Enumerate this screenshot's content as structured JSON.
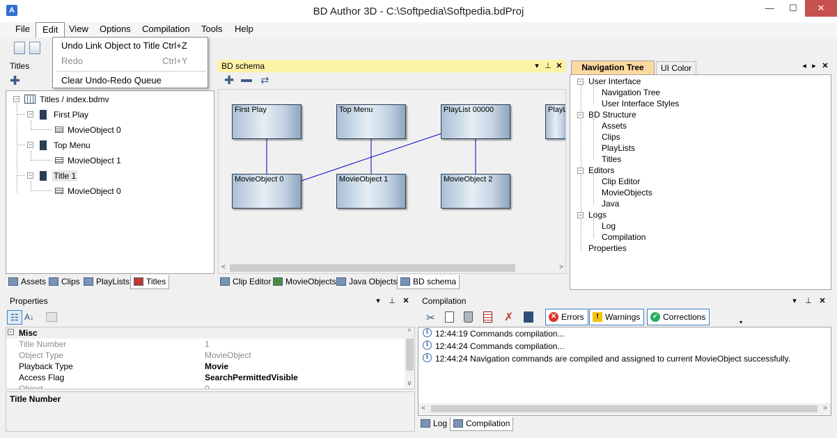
{
  "window": {
    "title": "BD Author 3D - C:\\Softpedia\\Softpedia.bdProj",
    "app_icon_letter": "A",
    "minimize": "—",
    "maximize": "☐",
    "close": "✕"
  },
  "menu": [
    "File",
    "Edit",
    "View",
    "Options",
    "Compilation",
    "Tools",
    "Help"
  ],
  "edit_menu": {
    "items": [
      {
        "label": "Undo Link Object to Title",
        "shortcut": "Ctrl+Z",
        "enabled": true
      },
      {
        "label": "Redo",
        "shortcut": "Ctrl+Y",
        "enabled": false
      },
      {
        "label": "Clear Undo-Redo Queue",
        "shortcut": "",
        "enabled": true
      }
    ]
  },
  "titles_panel": {
    "title": "Titles",
    "tree": [
      {
        "label": "Titles / index.bdmv"
      },
      {
        "label": "First Play"
      },
      {
        "label": "MovieObject 0"
      },
      {
        "label": "Top Menu"
      },
      {
        "label": "MovieObject 1"
      },
      {
        "label": "Title 1"
      },
      {
        "label": "MovieObject 0"
      }
    ],
    "tabs": [
      "Assets",
      "Clips",
      "PlayLists",
      "Titles"
    ],
    "active_tab": "Titles"
  },
  "schema_panel": {
    "title": "BD schema",
    "nodes": [
      "First Play",
      "Top Menu",
      "PlayList 00000",
      "PlayLi",
      "MovieObject 0",
      "MovieObject 1",
      "MovieObject 2"
    ],
    "tabs": [
      "Clip Editor",
      "MovieObjects",
      "Java Objects",
      "BD schema"
    ],
    "active_tab": "BD schema"
  },
  "nav_panel": {
    "tabs": [
      "Navigation Tree",
      "UI Color"
    ],
    "active_tab": "Navigation Tree",
    "tree": [
      {
        "label": "User Interface"
      },
      {
        "label": "Navigation Tree"
      },
      {
        "label": "User Interface Styles"
      },
      {
        "label": "BD Structure"
      },
      {
        "label": "Assets"
      },
      {
        "label": "Clips"
      },
      {
        "label": "PlayLists"
      },
      {
        "label": "Titles"
      },
      {
        "label": "Editors"
      },
      {
        "label": "Clip Editor"
      },
      {
        "label": "MovieObjects"
      },
      {
        "label": "Java"
      },
      {
        "label": "Logs"
      },
      {
        "label": "Log"
      },
      {
        "label": "Compilation"
      },
      {
        "label": "Properties"
      }
    ]
  },
  "properties_panel": {
    "title": "Properties",
    "category": "Misc",
    "rows": [
      {
        "name": "Title Number",
        "value": "1",
        "readonly": true
      },
      {
        "name": "Object Type",
        "value": "MovieObject",
        "readonly": true
      },
      {
        "name": "Playback Type",
        "value": "Movie",
        "readonly": false
      },
      {
        "name": "Access Flag",
        "value": "SearchPermittedVisible",
        "readonly": false
      },
      {
        "name": "Object",
        "value": "0",
        "readonly": true
      }
    ],
    "description_title": "Title Number"
  },
  "compilation_panel": {
    "title": "Compilation",
    "buttons": [
      "Errors",
      "Warnings",
      "Corrections"
    ],
    "log": [
      "12:44:19 Commands compilation...",
      "12:44:24 Commands compilation...",
      "12:44:24 Navigation commands are compiled and assigned to current MovieObject successfully."
    ],
    "tabs": [
      "Log",
      "Compilation"
    ],
    "active_tab": "Compilation"
  },
  "colors": {
    "accent_title": "#fdf3a7",
    "active_tab": "#fcd9a1",
    "link_line": "#0000cc"
  }
}
